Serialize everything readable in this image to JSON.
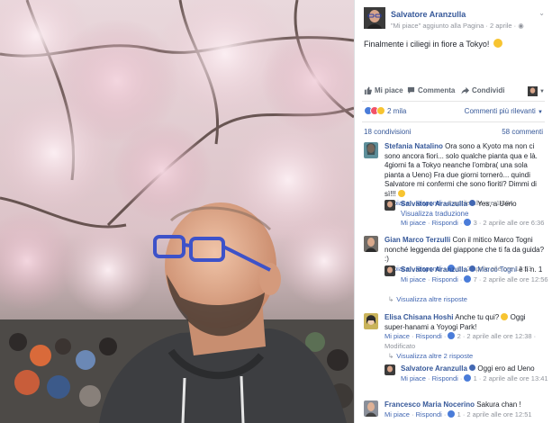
{
  "post": {
    "author": "Salvatore Aranzulla",
    "sub_liked": "\"Mi piace\" aggiunto alla Pagina",
    "sub_sep": " · ",
    "date": "2 aprile",
    "text": "Finalmente i ciliegi in fiore a Tokyo!"
  },
  "actions": {
    "like": "Mi piace",
    "comment": "Commenta",
    "share": "Condividi"
  },
  "reactions": {
    "count": "2 mila",
    "sort_label": "Commenti più rilevanti"
  },
  "stats": {
    "shares": "18 condivisioni",
    "comments": "58 commenti"
  },
  "comments": [
    {
      "name": "Stefania Natalino",
      "text": "Ora sono a Kyoto ma non ci sono ancora fiori... solo qualche pianta qua e là. 4giorni fa a Tokyo neanche l'ombra( una sola pianta a Ueno) Fra due giorni tornerò... quindi Salvatore mi confermi che sono fioriti? Dimmi di sì!!!",
      "like": "Mi piace",
      "reply": "Rispondi",
      "time": "2 aprile alle ore 14:04"
    },
    {
      "name": "Salvatore Aranzulla",
      "text": "Yes, a Ueno",
      "translate": "Visualizza traduzione",
      "like": "Mi piace",
      "reply": "Rispondi",
      "likes": "3",
      "time": "2 aprile alle ore 6:36"
    },
    {
      "name": "Gian Marco Terzulli",
      "text": "Con il mitico Marco Togni nonché leggenda del giappone che ti fa da guida? :)",
      "like": "Mi piace",
      "reply": "Rispondi",
      "likes": "6",
      "time": "2 aprile alle ore 12:53"
    },
    {
      "name": "Salvatore Aranzulla",
      "mention": "Marco Togni",
      "text": "è lì n. 1",
      "like": "Mi piace",
      "reply": "Rispondi",
      "likes": "7",
      "time": "2 aprile alle ore 12:56"
    },
    {
      "more": "Visualizza altre risposte"
    },
    {
      "name": "Elisa Chisana Hoshi",
      "text": "Anche tu qui?",
      "text2": "Oggi super-hanami a Yoyogi Park!",
      "like": "Mi piace",
      "reply": "Rispondi",
      "likes": "2",
      "time": "2 aprile alle ore 12:38",
      "edited": "Modificato"
    },
    {
      "more": "Visualizza altre 2 risposte"
    },
    {
      "name": "Salvatore Aranzulla",
      "text": "Oggi ero ad Ueno",
      "like": "Mi piace",
      "reply": "Rispondi",
      "likes": "1",
      "time": "2 aprile alle ore 13:41"
    },
    {
      "name": "Francesco Maria Nocerino",
      "text": "Sakura chan !",
      "like": "Mi piace",
      "reply": "Rispondi",
      "likes": "1",
      "time": "2 aprile alle ore 12:51"
    }
  ],
  "colors": {
    "link": "#365899",
    "meta": "#90949c",
    "like_blue": "#4267b2",
    "love_red": "#f25268",
    "wow_yellow": "#f7c431"
  },
  "icons": [
    "thumbs-up-icon",
    "comment-icon",
    "share-icon",
    "chevron-down-icon",
    "verified-icon",
    "like-reaction-icon",
    "love-reaction-icon",
    "wow-reaction-icon",
    "reply-arrow-icon",
    "smile-emoji-icon"
  ]
}
